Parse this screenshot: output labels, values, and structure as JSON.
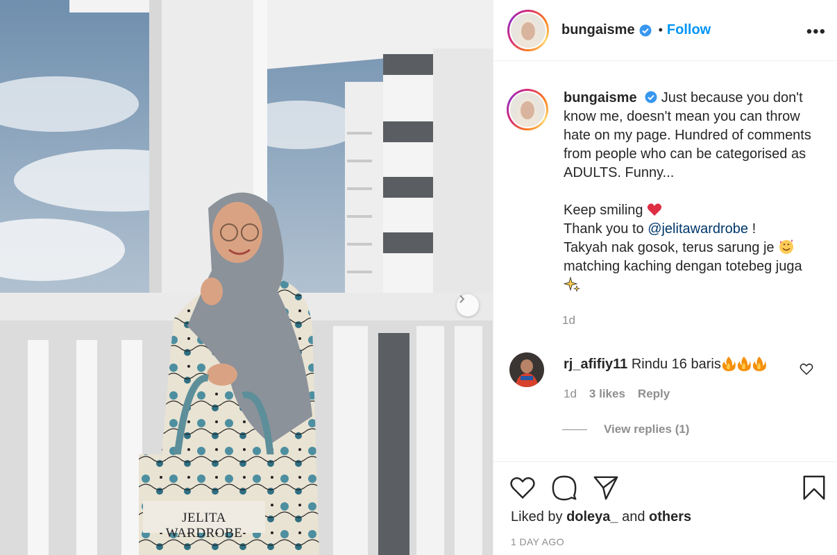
{
  "post": {
    "image_label": "JELITA WARDROBE"
  },
  "header": {
    "username": "bungaisme",
    "separator": "•",
    "follow_label": "Follow",
    "more_label": "•••"
  },
  "caption": {
    "username": "bungaisme",
    "line1": "Just because you don't know me, doesn't mean you can throw hate on my page. Hundred of comments from people who can be categorised as ADULTS. Funny...",
    "keep_smiling": "Keep smiling",
    "thank_prefix": "Thank you to",
    "mention": "@jelitawardrobe",
    "thank_suffix": " !",
    "line_takyah": "Takyah nak gosok, terus sarung je",
    "line_matching": "matching kaching dengan totebeg juga",
    "time": "1d"
  },
  "comment": {
    "username": "rj_afifiy11",
    "text": "Rindu 16 baris",
    "time": "1d",
    "likes": "3 likes",
    "reply_label": "Reply",
    "view_replies": "View replies (1)"
  },
  "footer": {
    "liked_by_prefix": "Liked by",
    "liked_by_user": "doleya_",
    "liked_by_and": "and",
    "liked_by_others": "others",
    "date": "1 DAY AGO"
  },
  "icons": {
    "like": "heart-icon",
    "comment": "comment-bubble-icon",
    "share": "paper-plane-icon",
    "save": "bookmark-icon",
    "verified": "verified-badge-icon",
    "next": "chevron-right-icon"
  },
  "colors": {
    "accent": "#0095f6",
    "verified": "#3897f0",
    "text": "#262626",
    "muted": "#8e8e8e",
    "mention": "#00376b"
  }
}
